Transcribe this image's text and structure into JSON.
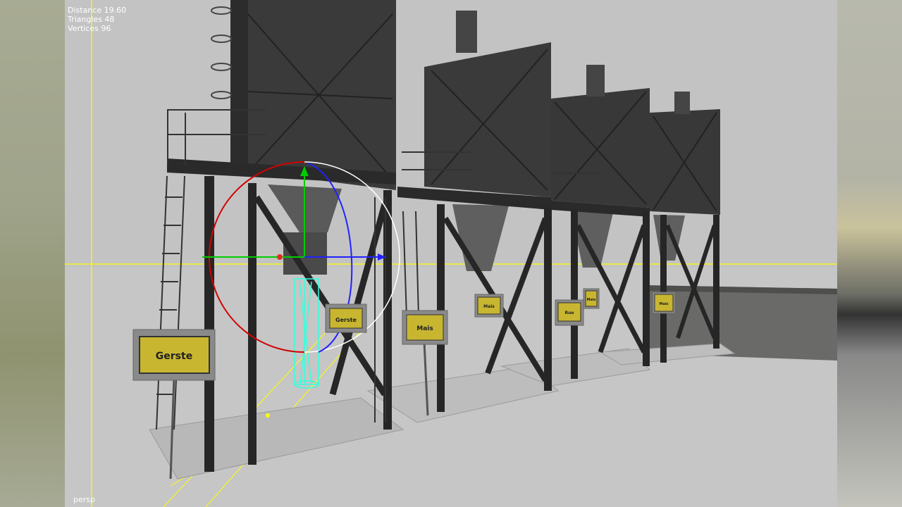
{
  "viewport": {
    "stats": {
      "distance": "Distance 19.60",
      "triangles": "Triangles 48",
      "vertices": "Vertices 96"
    },
    "camera_label": "persp"
  },
  "signs": {
    "sign1": "Gerste",
    "sign2": "Gerste",
    "sign3": "Mais",
    "sign4": "Mais",
    "sign5": "Rue",
    "sign6": "Mais",
    "sign7": "Mais"
  },
  "colors": {
    "viewport_bg": "#c3c3c3",
    "axis_line": "#ffff00",
    "gizmo_x": "#00cc00",
    "gizmo_y_ring": "#cc0000",
    "gizmo_z": "#1a1aff",
    "selection": "#33ffdd",
    "sign_bg": "#c8b631"
  },
  "icons": {
    "move_gizmo": "transform-gizmo-icon",
    "rotate_gizmo": "rotate-gizmo-icon"
  }
}
